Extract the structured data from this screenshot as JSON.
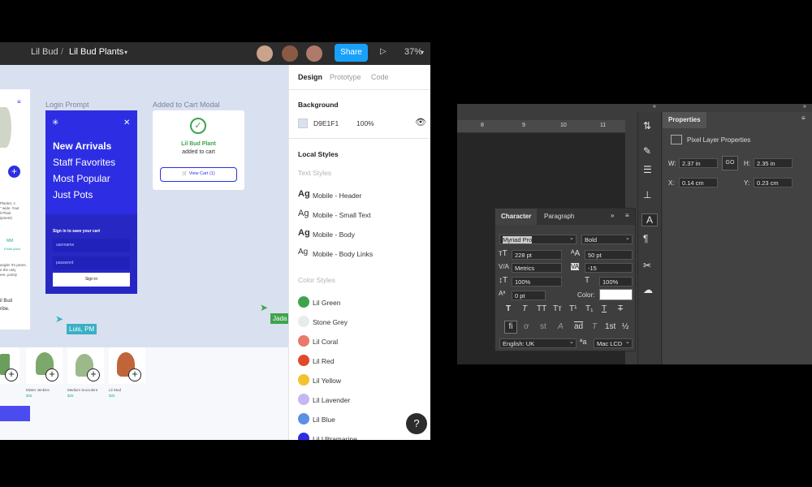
{
  "figma": {
    "breadcrumb": {
      "project": "Lil Bud",
      "separator": "/",
      "file": "Lil Bud Plants"
    },
    "share_label": "Share",
    "zoom": "37%",
    "panel_tabs": [
      "Design",
      "Prototype",
      "Code"
    ],
    "background": {
      "heading": "Background",
      "hex": "D9E1F1",
      "opacity": "100%"
    },
    "local_styles_heading": "Local Styles",
    "text_styles_heading": "Text Styles",
    "text_styles": [
      "Mobile - Header",
      "Mobile - Small Text",
      "Mobile - Body",
      "Mobile - Body Links"
    ],
    "text_style_glyph": "Ag",
    "color_styles_heading": "Color Styles",
    "color_styles": [
      {
        "name": "Lil Green",
        "color": "#3fa34d"
      },
      {
        "name": "Stone Grey",
        "color": "#e8ebe9"
      },
      {
        "name": "Lil Coral",
        "color": "#e8796b"
      },
      {
        "name": "Lil Red",
        "color": "#e04a2b"
      },
      {
        "name": "Lil Yellow",
        "color": "#f2c230"
      },
      {
        "name": "Lil Lavender",
        "color": "#c4b8f0"
      },
      {
        "name": "Lil Blue",
        "color": "#5a8fe6"
      },
      {
        "name": "Lil Ultramarine",
        "color": "#2d2ee3"
      }
    ],
    "help_label": "?",
    "canvas": {
      "login_frame_label": "Login Prompt",
      "cart_frame_label": "Added to Cart Modal",
      "login_nav": [
        "New Arrivals",
        "Staff Favorites",
        "Most Popular",
        "Just Pots"
      ],
      "login_prompt": "Sign in to save your cart",
      "username_placeholder": "username",
      "password_placeholder": "password",
      "sign_in_label": "Sign in",
      "modal_title": "Lil Bud Plant",
      "modal_sub": "added to cart",
      "view_cart_label": "View Cart (1)",
      "cursor_luis": "Luis, PM",
      "cursor_jada": "Jada",
      "left_frame_fragments": [
        "Planter, s",
        "\" wide. Yout",
        "il Plant",
        "ipment)",
        "MM",
        "Email plant",
        "angle! It's pears.",
        "e the only",
        "ere, pointy",
        "il Bud",
        "ribe."
      ],
      "plants": [
        {
          "name": "Mister Jenkins",
          "price": "$25"
        },
        {
          "name": "Medium Succulent",
          "price": "$25"
        },
        {
          "name": "Lil Stud",
          "price": "$25"
        }
      ]
    }
  },
  "photoshop": {
    "properties_tab": "Properties",
    "pixel_layer_label": "Pixel Layer Properties",
    "w_label": "W:",
    "w_value": "2.37 in",
    "h_label": "H:",
    "h_value": "2.35 in",
    "x_label": "X:",
    "x_value": "0.14 cm",
    "y_label": "Y:",
    "y_value": "0.23 cm",
    "link_label": "GO",
    "ruler": [
      "8",
      "9",
      "10",
      "11"
    ],
    "character": {
      "tab_character": "Character",
      "tab_paragraph": "Paragraph",
      "font_family": "Myriad Pro",
      "font_style": "Bold",
      "font_size": "228 pt",
      "leading": "50 pt",
      "kerning": "Metrics",
      "tracking": "-15",
      "vertical_scale": "100%",
      "horizontal_scale": "100%",
      "baseline_shift": "0 pt",
      "color_label": "Color:",
      "language": "English: UK",
      "aa_glyph": "ªa",
      "anti_alias": "Mac LCD",
      "style_buttons": [
        "T",
        "T",
        "TT",
        "Tт",
        "T¹",
        "T₁",
        "T",
        "T"
      ],
      "opentype_buttons": [
        "fi",
        "ơ",
        "st",
        "A",
        "ad",
        "T",
        "1st",
        "½"
      ]
    }
  }
}
